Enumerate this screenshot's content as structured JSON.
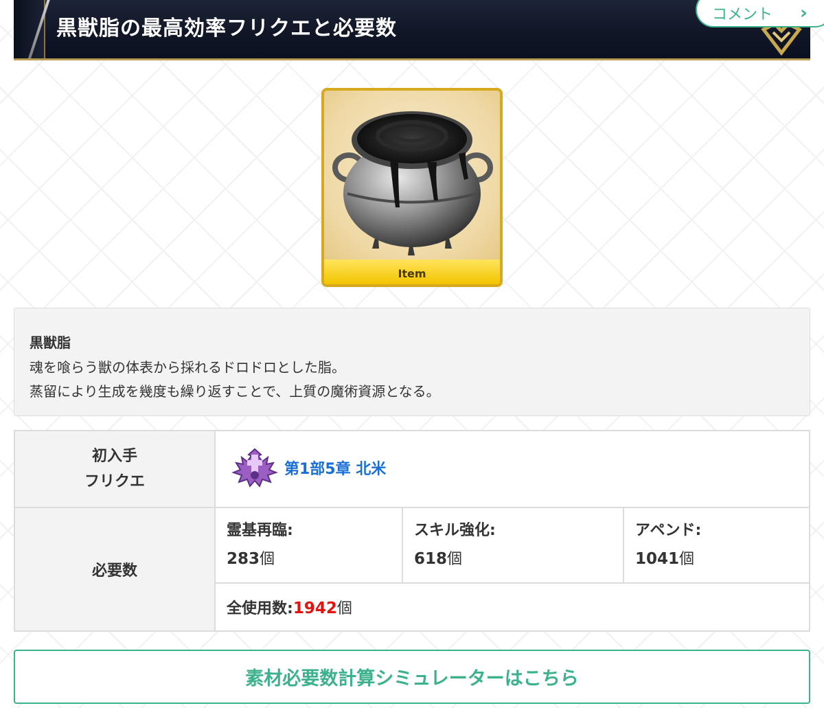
{
  "header": {
    "title": "黒獣脂の最高効率フリクエと必要数",
    "comment_label": "コメント"
  },
  "item": {
    "badge": "Item",
    "name": "黒獣脂",
    "description_lines": [
      "魂を喰らう獣の体表から採れるドロドロとした脂。",
      "蒸留により生成を幾度も繰り返すことで、上質の魔術資源となる。"
    ]
  },
  "info": {
    "first_label_line1": "初入手",
    "first_label_line2": "フリクエ",
    "first_value": "第1部5章 北米",
    "required_label": "必要数",
    "ascension_label": "霊基再臨:",
    "ascension_value": "283",
    "skill_label": "スキル強化:",
    "skill_value": "618",
    "append_label": "アペンド:",
    "append_value": "1041",
    "unit": "個",
    "total_label": "全使用数:",
    "total_value": "1942"
  },
  "simulator_button": "素材必要数計算シミュレーターはこちら",
  "colors": {
    "accent_green": "#3bb18c",
    "link_blue": "#1a6fd6",
    "total_red": "#e3130f",
    "item_frame_gold": "#d6a91e"
  }
}
